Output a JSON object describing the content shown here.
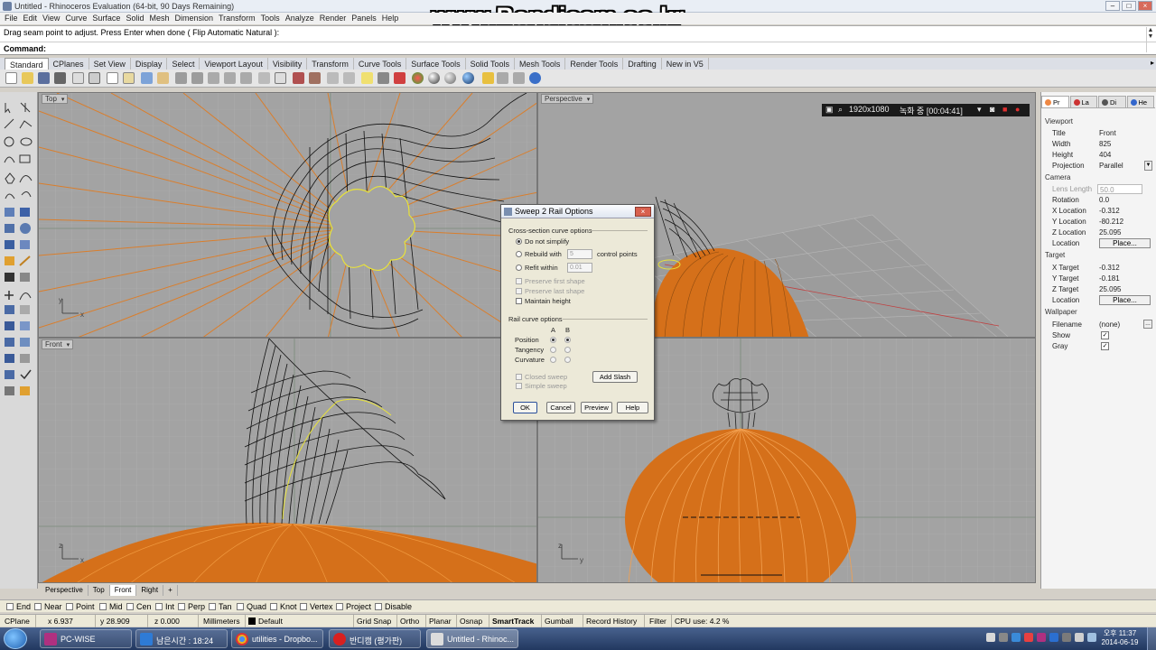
{
  "window": {
    "title": "Untitled - Rhinoceros Evaluation (64-bit, 90 Days Remaining)",
    "controls": [
      "–",
      "□",
      "×"
    ]
  },
  "watermark": "www.Bandicam.co.kr",
  "menu": [
    "File",
    "Edit",
    "View",
    "Curve",
    "Surface",
    "Solid",
    "Mesh",
    "Dimension",
    "Transform",
    "Tools",
    "Analyze",
    "Render",
    "Panels",
    "Help"
  ],
  "command": {
    "history": "Drag seam point to adjust. Press Enter when done ( Flip  Automatic  Natural ):",
    "prompt": "Command:"
  },
  "toolbar_tabs": [
    "Standard",
    "CPlanes",
    "Set View",
    "Display",
    "Select",
    "Viewport Layout",
    "Visibility",
    "Transform",
    "Curve Tools",
    "Surface Tools",
    "Solid Tools",
    "Mesh Tools",
    "Render Tools",
    "Drafting",
    "New in V5"
  ],
  "viewports": {
    "top": "Top",
    "perspective": "Perspective",
    "front": "Front",
    "right": "Right"
  },
  "recorder": {
    "resolution": "1920x1080",
    "status": "녹화 중 [00:04:41]"
  },
  "dialog": {
    "title": "Sweep 2 Rail Options",
    "cross_section_header": "Cross-section curve options",
    "do_not_simplify": "Do not simplify",
    "rebuild_with": "Rebuild with",
    "rebuild_value": "5",
    "control_points": "control points",
    "refit_within": "Refit within",
    "refit_value": "0.01",
    "preserve_first": "Preserve first shape",
    "preserve_last": "Preserve last shape",
    "maintain_height": "Maintain height",
    "rail_header": "Rail curve options",
    "col_a": "A",
    "col_b": "B",
    "position": "Position",
    "tangency": "Tangency",
    "curvature": "Curvature",
    "closed_sweep": "Closed sweep",
    "simple_sweep": "Simple sweep",
    "add_slash": "Add Slash",
    "ok": "OK",
    "cancel": "Cancel",
    "preview": "Preview",
    "help": "Help"
  },
  "properties": {
    "tabs": [
      "Pr",
      "La",
      "Di",
      "He"
    ],
    "viewport_header": "Viewport",
    "title_k": "Title",
    "title_v": "Front",
    "width_k": "Width",
    "width_v": "825",
    "height_k": "Height",
    "height_v": "404",
    "projection_k": "Projection",
    "projection_v": "Parallel",
    "camera_header": "Camera",
    "lens_k": "Lens Length",
    "lens_v": "50.0",
    "rotation_k": "Rotation",
    "rotation_v": "0.0",
    "xloc_k": "X Location",
    "xloc_v": "-0.312",
    "yloc_k": "Y Location",
    "yloc_v": "-80.212",
    "zloc_k": "Z Location",
    "zloc_v": "25.095",
    "loc_k": "Location",
    "place_btn": "Place...",
    "target_header": "Target",
    "xt_k": "X Target",
    "xt_v": "-0.312",
    "yt_k": "Y Target",
    "yt_v": "-0.181",
    "zt_k": "Z Target",
    "zt_v": "25.095",
    "wallpaper_header": "Wallpaper",
    "filename_k": "Filename",
    "filename_v": "(none)",
    "show_k": "Show",
    "gray_k": "Gray",
    "check": "✓"
  },
  "viewport_tabs": [
    "Perspective",
    "Top",
    "Front",
    "Right",
    "+"
  ],
  "osnaps": [
    "End",
    "Near",
    "Point",
    "Mid",
    "Cen",
    "Int",
    "Perp",
    "Tan",
    "Quad",
    "Knot",
    "Vertex",
    "Project",
    "Disable"
  ],
  "status": {
    "cplane": "CPlane",
    "x": "x 6.937",
    "y": "y 28.909",
    "z": "z 0.000",
    "units": "Millimeters",
    "layer": "Default",
    "grid_snap": "Grid Snap",
    "ortho": "Ortho",
    "planar": "Planar",
    "osnap": "Osnap",
    "smarttrack": "SmartTrack",
    "gumball": "Gumball",
    "record_history": "Record History",
    "filter": "Filter",
    "cpu": "CPU use: 4.2 %"
  },
  "taskbar": {
    "items": [
      "PC-WISE",
      "남은시간 : 18:24",
      "utilities - Dropbo...",
      "반디캠 (평가판)",
      "Untitled - Rhinoc..."
    ],
    "time": "오후 11:37",
    "date": "2014-06-19"
  },
  "colors": {
    "viewport_bg": "#a3a3a3",
    "orange": "#e07a1f",
    "selection": "#e8e23a"
  }
}
